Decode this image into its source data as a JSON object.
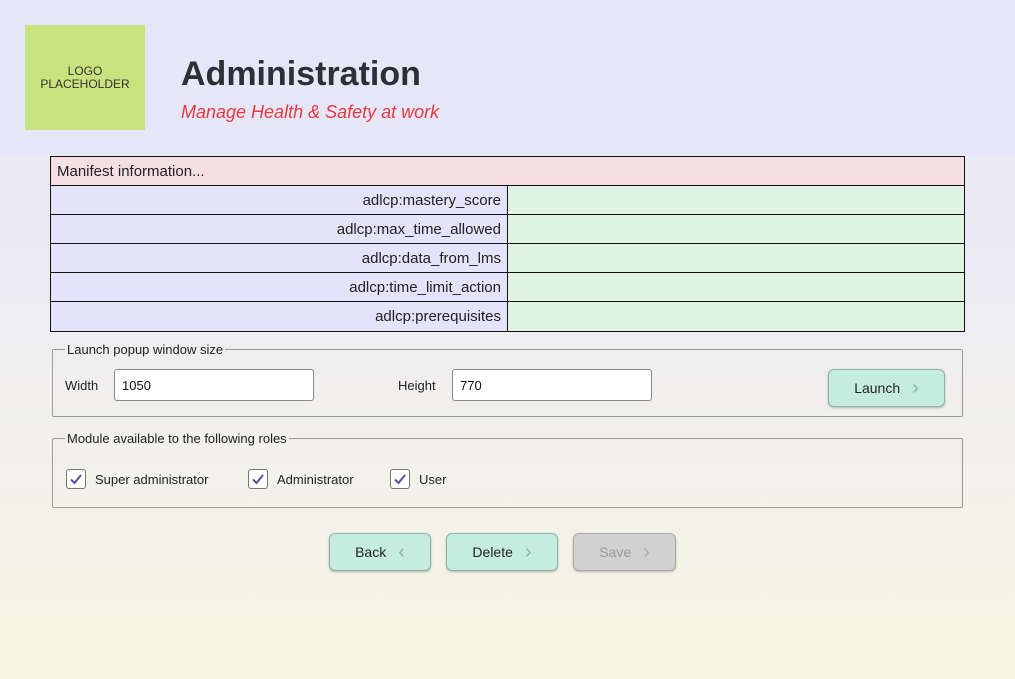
{
  "header": {
    "logo_line1": "LOGO",
    "logo_line2": "PLACEHOLDER",
    "title": "Administration",
    "subtitle": "Manage Health & Safety at work"
  },
  "manifest": {
    "heading": "Manifest information...",
    "rows": [
      {
        "key": "adlcp:mastery_score",
        "value": ""
      },
      {
        "key": "adlcp:max_time_allowed",
        "value": ""
      },
      {
        "key": "adlcp:data_from_lms",
        "value": ""
      },
      {
        "key": "adlcp:time_limit_action",
        "value": ""
      },
      {
        "key": "adlcp:prerequisites",
        "value": ""
      }
    ]
  },
  "popup": {
    "legend": "Launch popup window size",
    "width_label": "Width",
    "width_value": "1050",
    "height_label": "Height",
    "height_value": "770",
    "launch_label": "Launch"
  },
  "roles": {
    "legend": "Module available to the following roles",
    "items": [
      {
        "label": "Super administrator",
        "checked": true
      },
      {
        "label": "Administrator",
        "checked": true
      },
      {
        "label": "User",
        "checked": true
      }
    ]
  },
  "actions": {
    "back_label": "Back",
    "delete_label": "Delete",
    "save_label": "Save"
  },
  "colors": {
    "logo_bg": "#c8e37e",
    "subtitle": "#e3393f",
    "button_bg": "#c4ede0",
    "check": "#5b4f9a"
  },
  "icons": {
    "chevron_left": "chevron-left-icon",
    "chevron_right": "chevron-right-icon",
    "check": "check-icon"
  }
}
